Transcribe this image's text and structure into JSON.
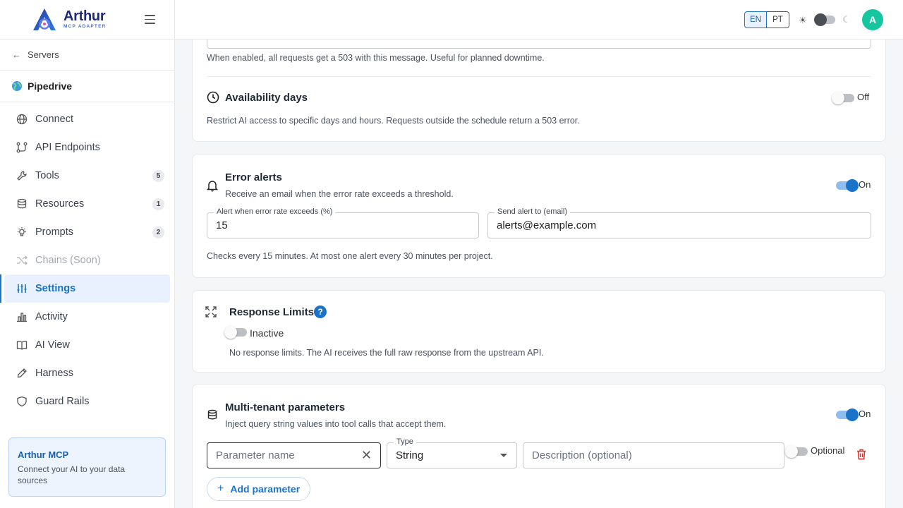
{
  "brand": {
    "name": "Arthur",
    "tagline": "MCP ADAPTER"
  },
  "sidebar": {
    "back_label": "Servers",
    "project_name": "Pipedrive",
    "items": [
      {
        "label": "Connect",
        "icon": "globe-icon",
        "badge": ""
      },
      {
        "label": "API Endpoints",
        "icon": "api-icon",
        "badge": ""
      },
      {
        "label": "Tools",
        "icon": "wrench-icon",
        "badge": "5"
      },
      {
        "label": "Resources",
        "icon": "database-icon",
        "badge": "1"
      },
      {
        "label": "Prompts",
        "icon": "lightbulb-icon",
        "badge": "2"
      },
      {
        "label": "Chains (Soon)",
        "icon": "shuffle-icon",
        "badge": ""
      },
      {
        "label": "Settings",
        "icon": "sliders-icon",
        "badge": ""
      },
      {
        "label": "Activity",
        "icon": "bar-chart-icon",
        "badge": ""
      },
      {
        "label": "AI View",
        "icon": "book-icon",
        "badge": ""
      },
      {
        "label": "Harness",
        "icon": "pen-icon",
        "badge": ""
      },
      {
        "label": "Guard Rails",
        "icon": "shield-icon",
        "badge": ""
      }
    ],
    "promo": {
      "title": "Arthur MCP",
      "text": "Connect your AI to your data sources"
    }
  },
  "topbar": {
    "lang_en": "EN",
    "lang_pt": "PT",
    "avatar_initial": "A"
  },
  "maintenance": {
    "hint": "When enabled, all requests get a 503 with this message. Useful for planned downtime."
  },
  "availability": {
    "title": "Availability days",
    "toggle_label": "Off",
    "description": "Restrict AI access to specific days and hours. Requests outside the schedule return a 503 error."
  },
  "error_alerts": {
    "title": "Error alerts",
    "subtitle": "Receive an email when the error rate exceeds a threshold.",
    "toggle_label": "On",
    "threshold_label": "Alert when error rate exceeds (%)",
    "threshold_value": "15",
    "email_label": "Send alert to (email)",
    "email_value": "alerts@example.com",
    "note": "Checks every 15 minutes. At most one alert every 30 minutes per project."
  },
  "response_limits": {
    "title": "Response Limits",
    "status": "Inactive",
    "description": "No response limits. The AI receives the full raw response from the upstream API."
  },
  "multi_tenant": {
    "title": "Multi-tenant parameters",
    "subtitle": "Inject query string values into tool calls that accept them.",
    "toggle_label": "On",
    "param_placeholder": "Parameter name",
    "type_label": "Type",
    "type_value": "String",
    "description_placeholder": "Description (optional)",
    "optional_label": "Optional",
    "add_button": "Add parameter"
  },
  "colors": {
    "accent": "#1a73c8",
    "avatar": "#16c6a1",
    "brand": "#1e2a78",
    "danger": "#d93025"
  }
}
